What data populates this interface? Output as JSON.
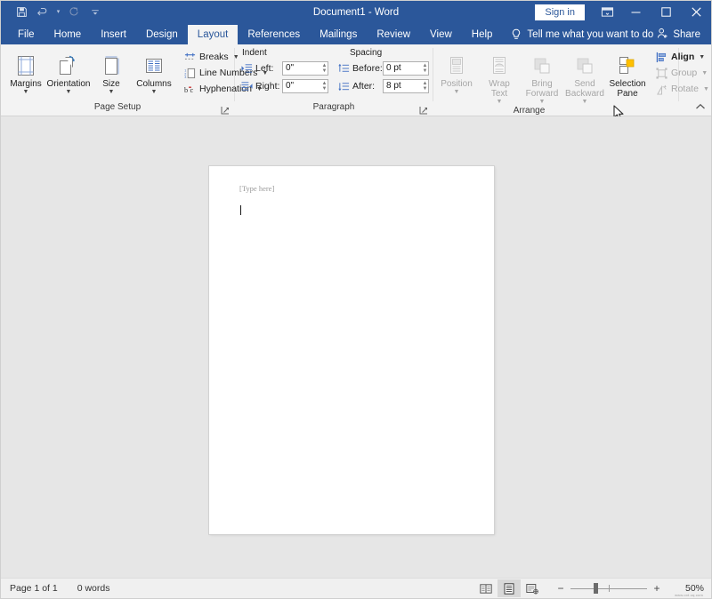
{
  "titlebar": {
    "document_title": "Document1  -  Word",
    "sign_in_label": "Sign in",
    "quick_access": [
      {
        "name": "save",
        "icon": "save-icon"
      },
      {
        "name": "undo",
        "icon": "undo-icon"
      },
      {
        "name": "redo",
        "icon": "redo-icon"
      },
      {
        "name": "customize-quick-access-toolbar",
        "icon": "chevron-down-icon"
      }
    ],
    "window_controls": {
      "ribbon_display_options": "ribbon-display-options-icon",
      "minimize": "minimize-icon",
      "maximize": "maximize-icon",
      "close": "close-icon"
    }
  },
  "tabs": [
    {
      "label": "File",
      "active": false
    },
    {
      "label": "Home",
      "active": false
    },
    {
      "label": "Insert",
      "active": false
    },
    {
      "label": "Design",
      "active": false
    },
    {
      "label": "Layout",
      "active": true
    },
    {
      "label": "References",
      "active": false
    },
    {
      "label": "Mailings",
      "active": false
    },
    {
      "label": "Review",
      "active": false
    },
    {
      "label": "View",
      "active": false
    },
    {
      "label": "Help",
      "active": false
    }
  ],
  "tell_me": {
    "label": "Tell me what you want to do",
    "icon": "lightbulb-icon"
  },
  "share": {
    "label": "Share",
    "icon": "share-person-icon"
  },
  "annotation": {
    "target": "Layout",
    "color": "#e01b24"
  },
  "ribbon": {
    "collapse_label": "collapse-ribbon-icon",
    "groups": [
      {
        "name": "page-setup",
        "label": "Page Setup",
        "has_launcher": true,
        "big_buttons": [
          {
            "label": "Margins",
            "icon": "margins-icon",
            "dropdown": true,
            "disabled": false
          },
          {
            "label": "Orientation",
            "icon": "orientation-icon",
            "dropdown": true,
            "disabled": false
          },
          {
            "label": "Size",
            "icon": "size-icon",
            "dropdown": true,
            "disabled": false
          },
          {
            "label": "Columns",
            "icon": "columns-icon",
            "dropdown": true,
            "disabled": false
          }
        ],
        "small_buttons": [
          {
            "label": "Breaks",
            "icon": "breaks-icon",
            "dropdown": true,
            "disabled": false
          },
          {
            "label": "Line Numbers",
            "icon": "line-numbers-icon",
            "dropdown": true,
            "disabled": false
          },
          {
            "label": "Hyphenation",
            "icon": "hyphenation-icon",
            "dropdown": true,
            "disabled": false
          }
        ]
      },
      {
        "name": "paragraph",
        "label": "Paragraph",
        "has_launcher": true,
        "indent_header": "Indent",
        "spacing_header": "Spacing",
        "fields": [
          {
            "label": "Left:",
            "value": "0\"",
            "icon": "indent-left-icon"
          },
          {
            "label": "Right:",
            "value": "0\"",
            "icon": "indent-right-icon"
          },
          {
            "label": "Before:",
            "value": "0 pt",
            "icon": "spacing-before-icon"
          },
          {
            "label": "After:",
            "value": "8 pt",
            "icon": "spacing-after-icon"
          }
        ]
      },
      {
        "name": "arrange",
        "label": "Arrange",
        "has_launcher": false,
        "big_buttons": [
          {
            "label": "Position",
            "icon": "position-icon",
            "dropdown": true,
            "disabled": true
          },
          {
            "label": "Wrap\nText",
            "icon": "wrap-text-icon",
            "dropdown": true,
            "disabled": true
          },
          {
            "label": "Bring\nForward",
            "icon": "bring-forward-icon",
            "dropdown": true,
            "disabled": true
          },
          {
            "label": "Send\nBackward",
            "icon": "send-backward-icon",
            "dropdown": true,
            "disabled": true
          },
          {
            "label": "Selection\nPane",
            "icon": "selection-pane-icon",
            "dropdown": false,
            "disabled": false
          }
        ],
        "small_buttons": [
          {
            "label": "Align",
            "icon": "align-icon",
            "dropdown": true,
            "disabled": false
          },
          {
            "label": "Group",
            "icon": "group-icon",
            "dropdown": true,
            "disabled": true
          },
          {
            "label": "Rotate",
            "icon": "rotate-icon",
            "dropdown": true,
            "disabled": true
          }
        ]
      }
    ]
  },
  "document": {
    "placeholder_text": "[Type here]",
    "caret_visible": true
  },
  "statusbar": {
    "page_info": "Page 1 of 1",
    "word_count": "0 words",
    "views": [
      {
        "name": "read-mode",
        "icon": "read-mode-icon",
        "active": false
      },
      {
        "name": "print-layout",
        "icon": "print-layout-icon",
        "active": true
      },
      {
        "name": "web-layout",
        "icon": "web-layout-icon",
        "active": false
      }
    ],
    "zoom_out": "−",
    "zoom_in": "+",
    "zoom_level": "50%",
    "watermark": "www.oxt.uq.com"
  }
}
